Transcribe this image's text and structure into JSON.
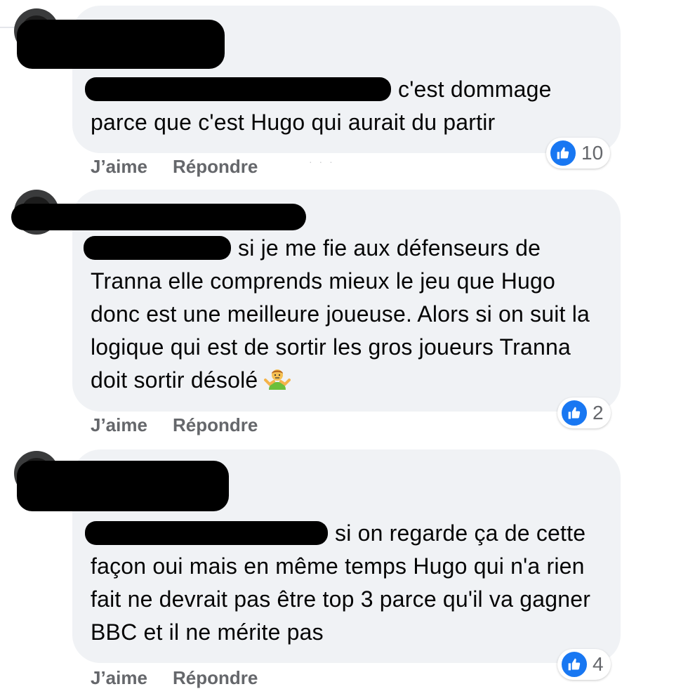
{
  "comments": [
    {
      "text": "c'est dommage parce que c'est Hugo qui aurait du partir",
      "like_label": "J’aime",
      "reply_label": "Répondre",
      "reaction_count": "10"
    },
    {
      "text": "si je me fie aux défenseurs de Tranna elle comprends mieux le jeu que Hugo donc est une meilleure joueuse. Alors si on suit la logique qui est de sortir les gros joueurs Tranna doit sortir désolé",
      "emoji": "person-shrugging-emoji",
      "like_label": "J’aime",
      "reply_label": "Répondre",
      "reaction_count": "2"
    },
    {
      "text": "si on regarde ça de cette façon oui mais en même temps Hugo qui n'a rien fait ne devrait pas être top 3 parce qu'il va gagner BBC et il ne mérite pas",
      "like_label": "J’aime",
      "reply_label": "Répondre",
      "reaction_count": "4"
    }
  ],
  "colors": {
    "bubble": "#f0f2f5",
    "action_text": "#65676b",
    "like_blue": "#1877f2",
    "redaction": "#000000"
  },
  "icons": {
    "reaction": "like-thumbs-up-icon"
  }
}
